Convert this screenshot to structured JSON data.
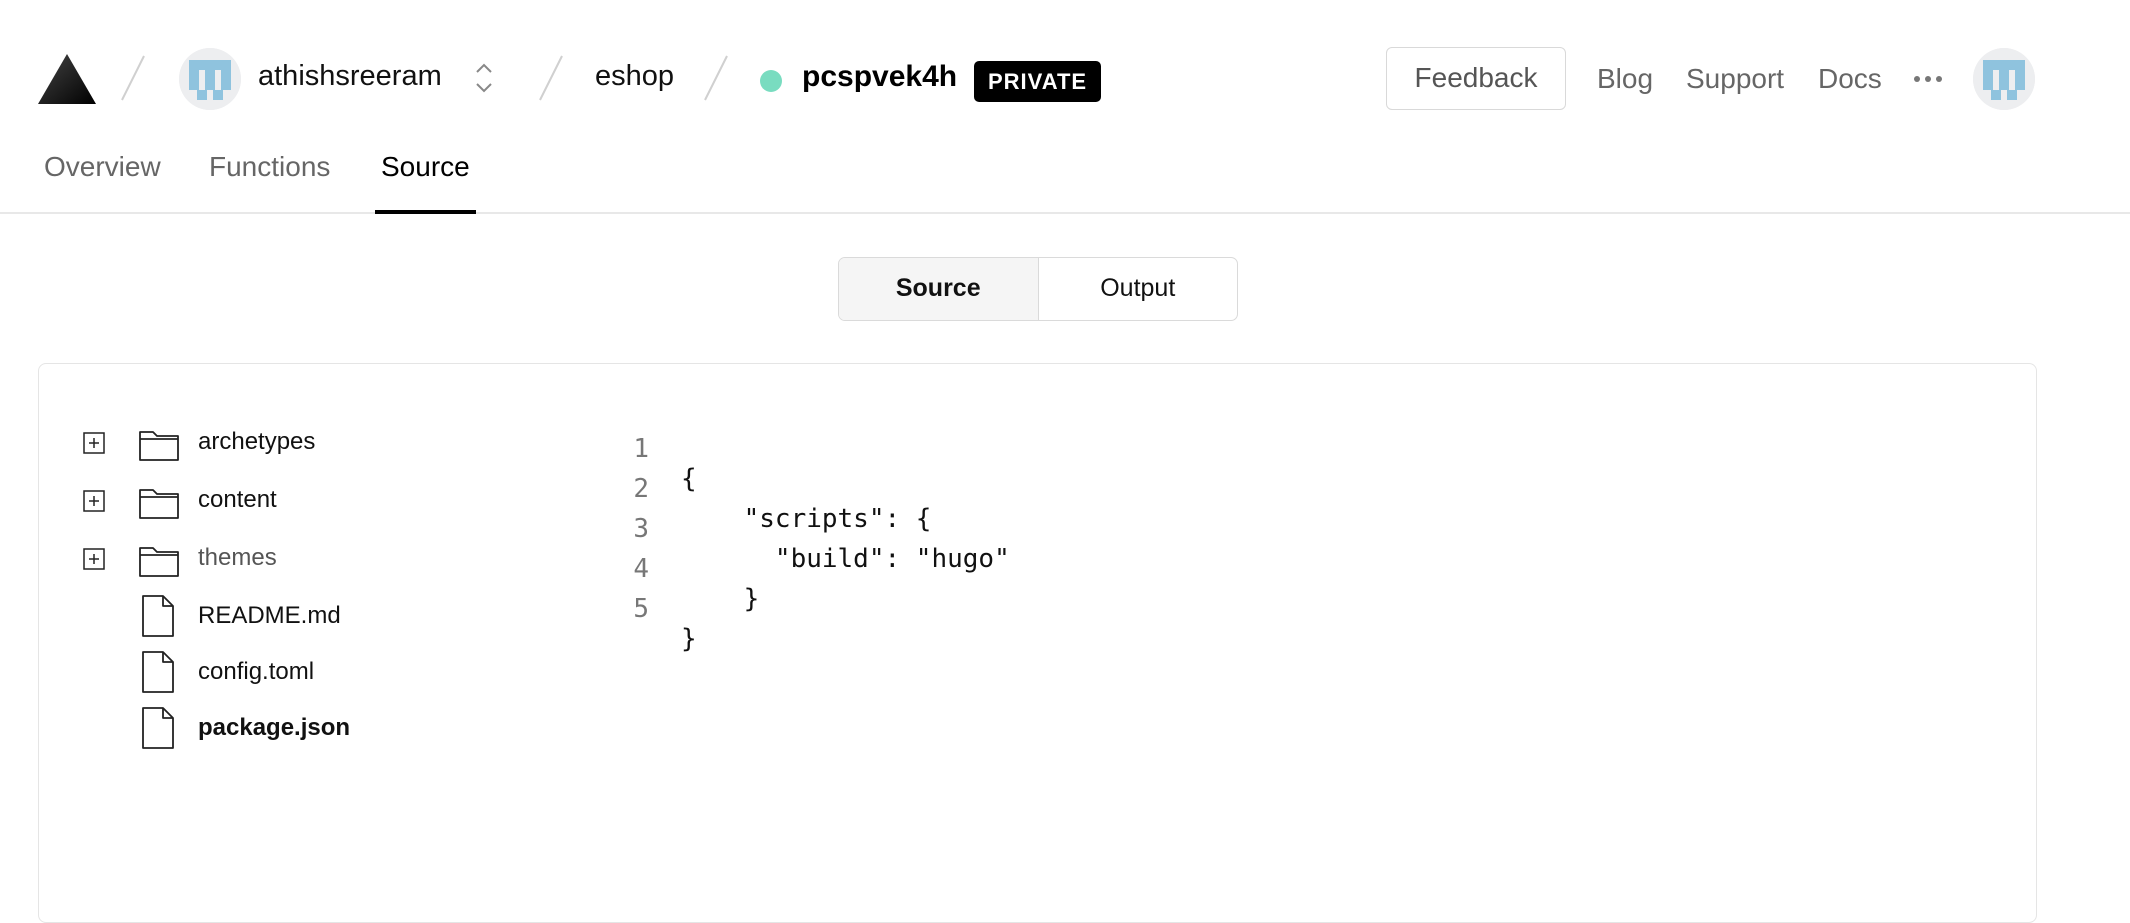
{
  "header": {
    "account": {
      "name": "athishsreeram"
    },
    "project": {
      "name": "eshop"
    },
    "deployment": {
      "name": "pcspvek4h",
      "badge": "PRIVATE",
      "status_color": "#79dcc0"
    },
    "feedback_label": "Feedback",
    "nav_links": [
      "Blog",
      "Support",
      "Docs"
    ]
  },
  "tabs": [
    {
      "label": "Overview",
      "active": false
    },
    {
      "label": "Functions",
      "active": false
    },
    {
      "label": "Source",
      "active": true
    }
  ],
  "view_toggle": {
    "options": [
      "Source",
      "Output"
    ],
    "selected": "Source"
  },
  "file_tree": [
    {
      "type": "folder",
      "name": "archetypes"
    },
    {
      "type": "folder",
      "name": "content"
    },
    {
      "type": "folder",
      "name": "themes"
    },
    {
      "type": "file",
      "name": "README.md"
    },
    {
      "type": "file",
      "name": "config.toml"
    },
    {
      "type": "file",
      "name": "package.json",
      "selected": true
    }
  ],
  "code": {
    "lines": [
      {
        "num": "1",
        "text": "{"
      },
      {
        "num": "2",
        "text": "    \"scripts\": {"
      },
      {
        "num": "3",
        "text": "      \"build\": \"hugo\""
      },
      {
        "num": "4",
        "text": "    }"
      },
      {
        "num": "5",
        "text": "}"
      }
    ]
  }
}
